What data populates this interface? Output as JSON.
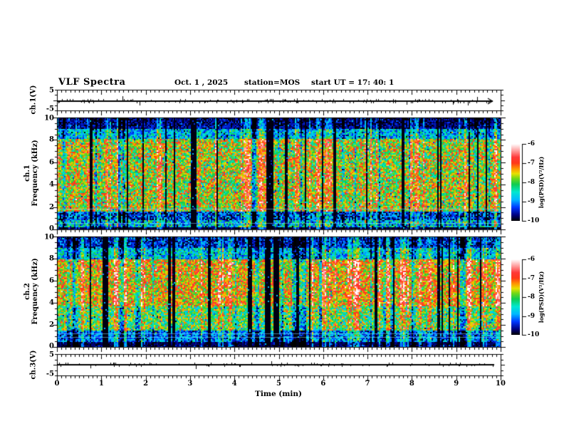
{
  "title": {
    "main": "VLF Spectra",
    "date": "Oct. 1 , 2025",
    "station": "station=MOS",
    "start_ut": "start UT =  17: 40: 1"
  },
  "axes": {
    "x": {
      "label": "Time (min)",
      "range_min": [
        0,
        10
      ],
      "ticks": [
        "0",
        "1",
        "2",
        "3",
        "4",
        "5",
        "6",
        "7",
        "8",
        "9",
        "10"
      ],
      "minor_interval_min": 0.1
    },
    "freq_ticks": [
      "10",
      "8",
      "6",
      "4",
      "2",
      "0"
    ],
    "freq_minor_interval_khz": 0.5,
    "amp_ticks": [
      "5",
      "-5"
    ]
  },
  "panels": {
    "ch1_amp": {
      "ylabel": "ch.1(V)",
      "y_range": [
        -5,
        5
      ]
    },
    "ch1_spec": {
      "ylabel_line1": "ch.1",
      "ylabel_line2": "Frequency (kHz)",
      "y_range_khz": [
        0,
        10
      ]
    },
    "ch2_spec": {
      "ylabel_line1": "ch.2",
      "ylabel_line2": "Frequency (kHz)",
      "y_range_khz": [
        0,
        10
      ]
    },
    "ch3_amp": {
      "ylabel": "ch.3(V)",
      "y_range": [
        -5,
        5
      ]
    }
  },
  "colorbar": {
    "label": "log(PSD)(V²/Hz)",
    "ticks": [
      "-6",
      "-7",
      "-8",
      "-9",
      "-10"
    ],
    "z_range": [
      -10,
      -6
    ],
    "colormap_stops": [
      [
        -10.0,
        "#000000"
      ],
      [
        -9.7,
        "#000080"
      ],
      [
        -9.3,
        "#0038ff"
      ],
      [
        -8.9,
        "#00b8ff"
      ],
      [
        -8.5,
        "#00e8d0"
      ],
      [
        -8.1,
        "#10cc50"
      ],
      [
        -7.8,
        "#70d818"
      ],
      [
        -7.55,
        "#e8e000"
      ],
      [
        -7.3,
        "#ff9800"
      ],
      [
        -7.0,
        "#ff3818"
      ],
      [
        -6.7,
        "#ff3838"
      ],
      [
        -6.35,
        "#ff9f9f"
      ],
      [
        -6.1,
        "#ffe4e4"
      ],
      [
        -6.0,
        "#ffffff"
      ]
    ]
  },
  "chart_data": [
    {
      "type": "line",
      "name": "ch1_voltage_trace",
      "ylabel": "ch.1(V)",
      "y_range": [
        -5,
        5
      ],
      "x_range_min": [
        0,
        10
      ],
      "mean_value_v": -0.35,
      "trace_end_min": 9.82,
      "arrow_at_end": true,
      "noise_spikes": 150,
      "seed": 7
    },
    {
      "type": "heatmap",
      "name": "ch1_spectrogram",
      "xlabel": "Time (min)",
      "ylabel": "ch.1 Frequency (kHz)",
      "zlabel": "log(PSD)(V²/Hz)",
      "x_range_min": [
        0,
        10
      ],
      "y_range_khz": [
        0,
        10
      ],
      "z_range": [
        -10,
        -6
      ],
      "bands": [
        {
          "f_khz": [
            9.05,
            10.01
          ],
          "level": -9.7,
          "noise": 0.4
        },
        {
          "f_khz": [
            8.1,
            9.05
          ],
          "level": -8.8,
          "noise": 0.7
        },
        {
          "f_khz": [
            1.7,
            8.1
          ],
          "level": -7.7,
          "noise": 0.85
        },
        {
          "f_khz": [
            0.9,
            1.7
          ],
          "level": -9.35,
          "noise": 0.7
        },
        {
          "f_khz": [
            0.3,
            0.9
          ],
          "level": -8.75,
          "noise": 0.9
        },
        {
          "f_khz": [
            0.0,
            0.3
          ],
          "level": -9.85,
          "noise": 0.15
        }
      ],
      "hlines_khz": [
        0.6,
        1.85
      ],
      "dropout_column_rate": 0.07,
      "strong_column_rate": 0.1,
      "weak_column_rate": 0.09,
      "strong_boost": 0.7,
      "weak_drop": 0.9,
      "seed": 1234
    },
    {
      "type": "heatmap",
      "name": "ch2_spectrogram",
      "xlabel": "Time (min)",
      "ylabel": "ch.2 Frequency (kHz)",
      "zlabel": "log(PSD)(V²/Hz)",
      "x_range_min": [
        0,
        10
      ],
      "y_range_khz": [
        0,
        10
      ],
      "z_range": [
        -10,
        -6
      ],
      "bands": [
        {
          "f_khz": [
            9.0,
            10.01
          ],
          "level": -9.4,
          "noise": 0.55
        },
        {
          "f_khz": [
            7.9,
            9.0
          ],
          "level": -8.7,
          "noise": 0.7
        },
        {
          "f_khz": [
            3.7,
            7.9
          ],
          "level": -7.4,
          "noise": 0.8
        },
        {
          "f_khz": [
            1.6,
            3.7
          ],
          "level": -8.0,
          "noise": 0.85
        },
        {
          "f_khz": [
            0.45,
            1.6
          ],
          "level": -9.1,
          "noise": 0.6
        },
        {
          "f_khz": [
            0.0,
            0.45
          ],
          "level": -9.8,
          "noise": 0.2
        }
      ],
      "hlines_khz": [
        0.9,
        1.2
      ],
      "dropout_column_rate": 0.06,
      "strong_column_rate": 0.13,
      "weak_column_rate": 0.07,
      "strong_boost": 0.75,
      "weak_drop": 0.9,
      "seed": 2468
    },
    {
      "type": "line",
      "name": "ch3_voltage_trace",
      "ylabel": "ch.3(V)",
      "y_range": [
        -5,
        5
      ],
      "x_range_min": [
        0,
        10
      ],
      "mean_value_v": 0.0,
      "trace_end_min": 9.85,
      "arrow_at_end": false,
      "noise_spikes": 90,
      "seed": 11
    }
  ]
}
